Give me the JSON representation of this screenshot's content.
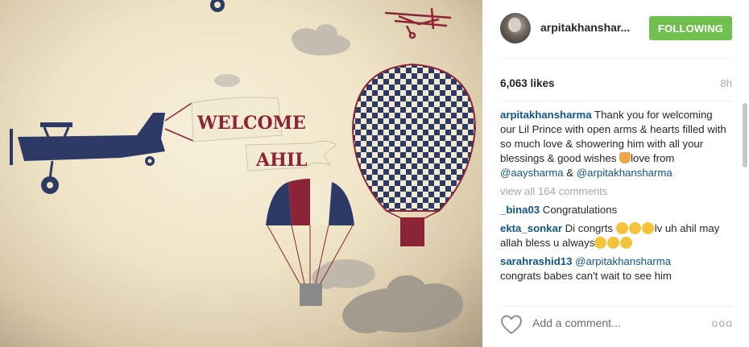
{
  "post": {
    "username": "arpitakhanshar...",
    "follow_label": "FOLLOWING",
    "likes": "6,063 likes",
    "time": "8h",
    "caption_user": "arpitakhansharma",
    "caption_text_1": " Thank you for welcoming our Lil Prince with open arms & hearts filled with so much love & showering him with all your blessings & good wishes ",
    "caption_text_2": "love from ",
    "caption_mention_1": "@aaysharma",
    "caption_text_3": " & ",
    "caption_mention_2": "@arpitakhansharma",
    "view_all": "view all 164 comments"
  },
  "comments": [
    {
      "user": "_bina03",
      "text": " Congratulations"
    },
    {
      "user": "ekta_sonkar",
      "text_1": " Di congrts ",
      "text_2": "lv uh ahil may allah bless u always"
    },
    {
      "user": "sarahrashid13",
      "mention": "@arpitakhansharma",
      "text": "congrats babes can't wait to see him "
    }
  ],
  "footer": {
    "add_comment_placeholder": "Add a comment...",
    "more_label": "ooo"
  },
  "image": {
    "banner_text": "WELCOME",
    "banner_name": "AHIL"
  },
  "colors": {
    "follow_green": "#70c050",
    "username_blue": "#125688",
    "navy": "#2e3a66",
    "maroon": "#8a2436"
  },
  "icons": [
    "heart-icon",
    "more-options-icon"
  ]
}
